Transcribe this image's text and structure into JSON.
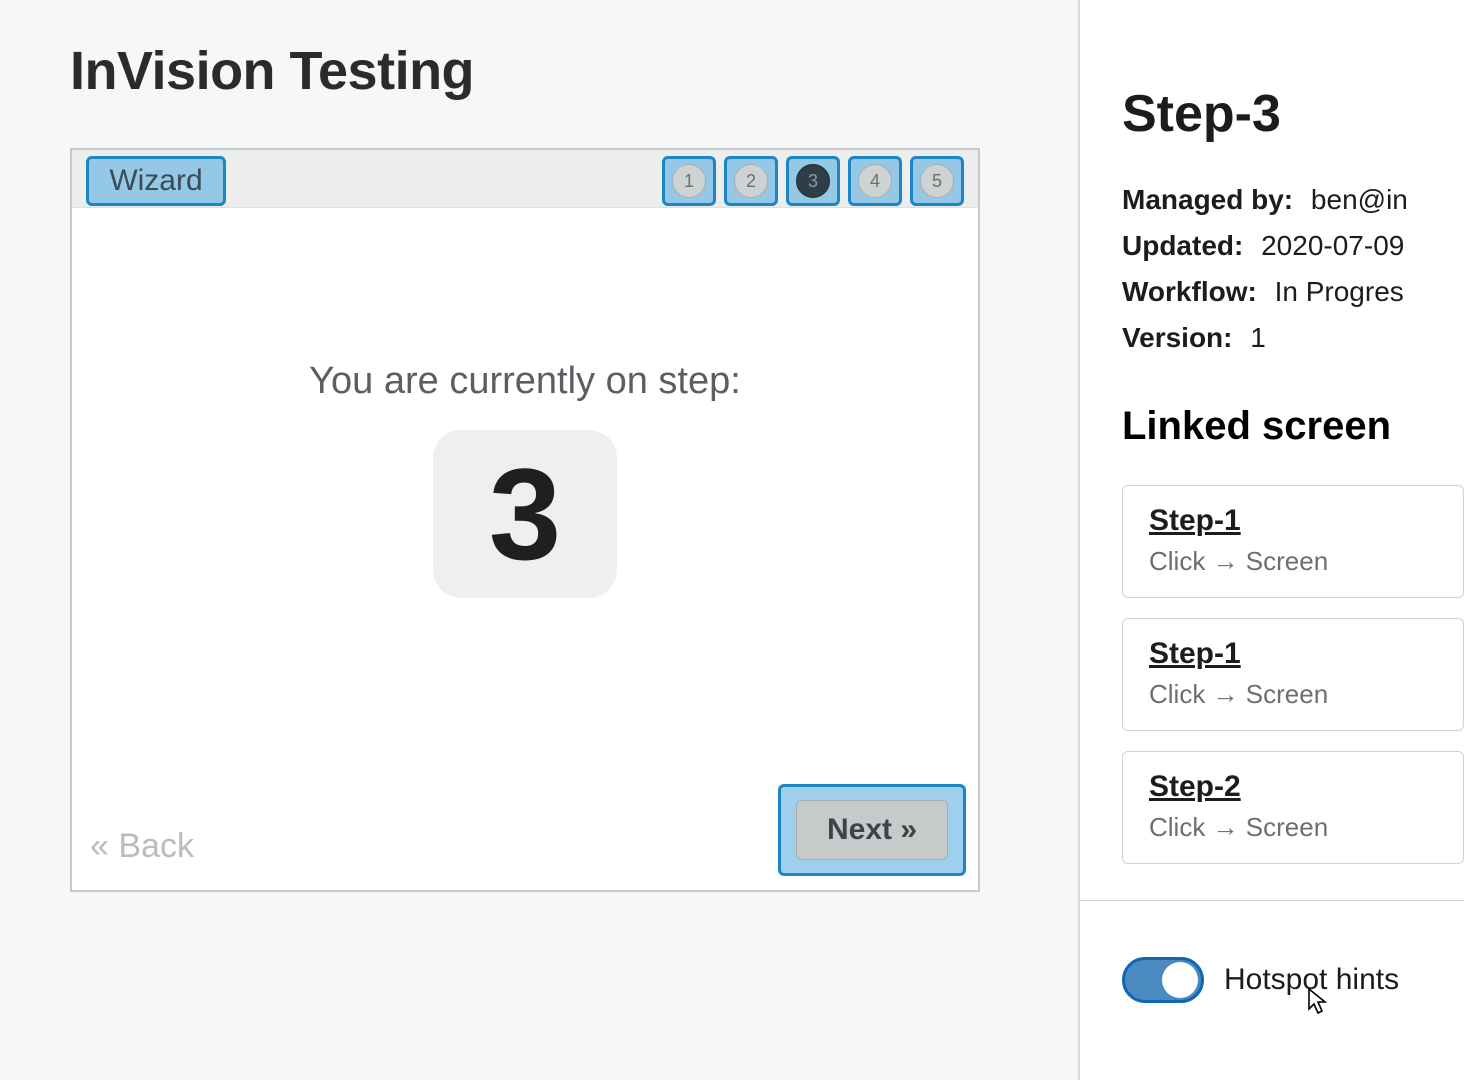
{
  "main": {
    "title": "InVision Testing",
    "wizard_label": "Wizard",
    "step_numbers": [
      "1",
      "2",
      "3",
      "4",
      "5"
    ],
    "current_step_index": 2,
    "center_text": "You are currently on step:",
    "big_step": "3",
    "back_label": "« Back",
    "next_label": "Next »"
  },
  "side": {
    "title": "Step-3",
    "meta": {
      "managed_by_label": "Managed by:",
      "managed_by_value": "ben@in",
      "updated_label": "Updated:",
      "updated_value": "2020-07-09",
      "workflow_label": "Workflow:",
      "workflow_value": "In Progres",
      "version_label": "Version:",
      "version_value": "1"
    },
    "linked_title": "Linked screen",
    "linked": [
      {
        "name": "Step-1",
        "sub": "Click → Screen"
      },
      {
        "name": "Step-1",
        "sub": "Click → Screen"
      },
      {
        "name": "Step-2",
        "sub": "Click → Screen"
      }
    ],
    "hints_label": "Hotspot hints",
    "hints_on": true
  }
}
